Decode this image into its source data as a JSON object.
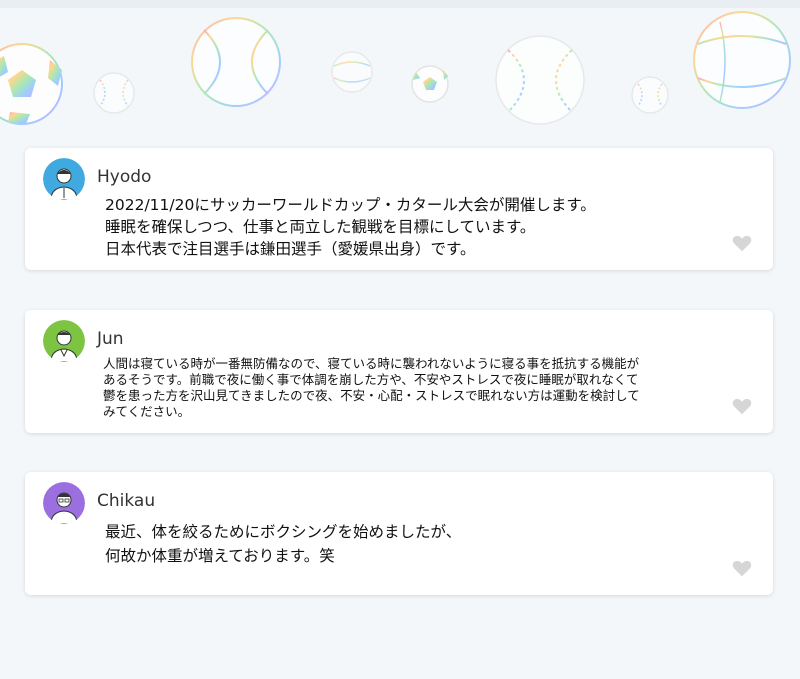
{
  "header": {
    "decoration": "sports-balls-banner"
  },
  "posts": [
    {
      "user": "Hyodo",
      "avatar_color": "#3fa9e0",
      "lines": [
        "2022/11/20にサッカーワールドカップ・カタール大会が開催します。",
        "睡眠を確保しつつ、仕事と両立した観戦を目標にしています。",
        "日本代表で注目選手は鎌田選手（愛媛県出身）です。"
      ],
      "like_icon": "heart-icon"
    },
    {
      "user": "Jun",
      "avatar_color": "#7dc443",
      "lines": [
        "人間は寝ている時が一番無防備なので、寝ている時に襲われないように寝る事を抵抗する機能が",
        "あるそうです。前職で夜に働く事で体調を崩した方や、不安やストレスで夜に睡眠が取れなくて",
        "鬱を患った方を沢山見てきましたので夜、不安・心配・ストレスで眠れない方は運動を検討して",
        "みてください。"
      ],
      "like_icon": "heart-icon"
    },
    {
      "user": "Chikau",
      "avatar_color": "#9b6fe0",
      "lines": [
        "最近、体を絞るためにボクシングを始めましたが、",
        "何故か体重が増えております。笑"
      ],
      "like_icon": "heart-icon"
    }
  ],
  "colors": {
    "background": "#f3f7fa",
    "card": "#ffffff",
    "heart": "#d6d6d6"
  }
}
